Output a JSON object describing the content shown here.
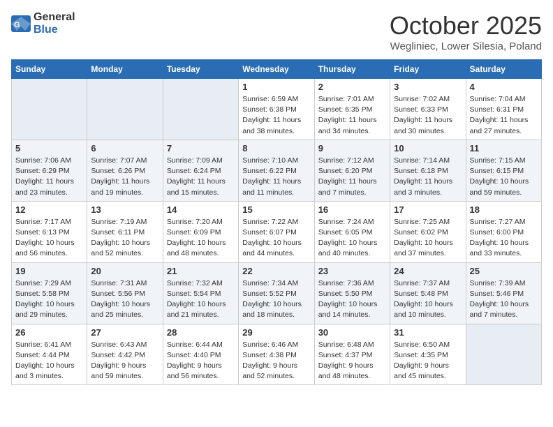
{
  "header": {
    "logo_general": "General",
    "logo_blue": "Blue",
    "month": "October 2025",
    "location": "Wegliniec, Lower Silesia, Poland"
  },
  "days_of_week": [
    "Sunday",
    "Monday",
    "Tuesday",
    "Wednesday",
    "Thursday",
    "Friday",
    "Saturday"
  ],
  "weeks": [
    [
      {
        "date": "",
        "info": ""
      },
      {
        "date": "",
        "info": ""
      },
      {
        "date": "",
        "info": ""
      },
      {
        "date": "1",
        "info": "Sunrise: 6:59 AM\nSunset: 6:38 PM\nDaylight: 11 hours\nand 38 minutes."
      },
      {
        "date": "2",
        "info": "Sunrise: 7:01 AM\nSunset: 6:35 PM\nDaylight: 11 hours\nand 34 minutes."
      },
      {
        "date": "3",
        "info": "Sunrise: 7:02 AM\nSunset: 6:33 PM\nDaylight: 11 hours\nand 30 minutes."
      },
      {
        "date": "4",
        "info": "Sunrise: 7:04 AM\nSunset: 6:31 PM\nDaylight: 11 hours\nand 27 minutes."
      }
    ],
    [
      {
        "date": "5",
        "info": "Sunrise: 7:06 AM\nSunset: 6:29 PM\nDaylight: 11 hours\nand 23 minutes."
      },
      {
        "date": "6",
        "info": "Sunrise: 7:07 AM\nSunset: 6:26 PM\nDaylight: 11 hours\nand 19 minutes."
      },
      {
        "date": "7",
        "info": "Sunrise: 7:09 AM\nSunset: 6:24 PM\nDaylight: 11 hours\nand 15 minutes."
      },
      {
        "date": "8",
        "info": "Sunrise: 7:10 AM\nSunset: 6:22 PM\nDaylight: 11 hours\nand 11 minutes."
      },
      {
        "date": "9",
        "info": "Sunrise: 7:12 AM\nSunset: 6:20 PM\nDaylight: 11 hours\nand 7 minutes."
      },
      {
        "date": "10",
        "info": "Sunrise: 7:14 AM\nSunset: 6:18 PM\nDaylight: 11 hours\nand 3 minutes."
      },
      {
        "date": "11",
        "info": "Sunrise: 7:15 AM\nSunset: 6:15 PM\nDaylight: 10 hours\nand 59 minutes."
      }
    ],
    [
      {
        "date": "12",
        "info": "Sunrise: 7:17 AM\nSunset: 6:13 PM\nDaylight: 10 hours\nand 56 minutes."
      },
      {
        "date": "13",
        "info": "Sunrise: 7:19 AM\nSunset: 6:11 PM\nDaylight: 10 hours\nand 52 minutes."
      },
      {
        "date": "14",
        "info": "Sunrise: 7:20 AM\nSunset: 6:09 PM\nDaylight: 10 hours\nand 48 minutes."
      },
      {
        "date": "15",
        "info": "Sunrise: 7:22 AM\nSunset: 6:07 PM\nDaylight: 10 hours\nand 44 minutes."
      },
      {
        "date": "16",
        "info": "Sunrise: 7:24 AM\nSunset: 6:05 PM\nDaylight: 10 hours\nand 40 minutes."
      },
      {
        "date": "17",
        "info": "Sunrise: 7:25 AM\nSunset: 6:02 PM\nDaylight: 10 hours\nand 37 minutes."
      },
      {
        "date": "18",
        "info": "Sunrise: 7:27 AM\nSunset: 6:00 PM\nDaylight: 10 hours\nand 33 minutes."
      }
    ],
    [
      {
        "date": "19",
        "info": "Sunrise: 7:29 AM\nSunset: 5:58 PM\nDaylight: 10 hours\nand 29 minutes."
      },
      {
        "date": "20",
        "info": "Sunrise: 7:31 AM\nSunset: 5:56 PM\nDaylight: 10 hours\nand 25 minutes."
      },
      {
        "date": "21",
        "info": "Sunrise: 7:32 AM\nSunset: 5:54 PM\nDaylight: 10 hours\nand 21 minutes."
      },
      {
        "date": "22",
        "info": "Sunrise: 7:34 AM\nSunset: 5:52 PM\nDaylight: 10 hours\nand 18 minutes."
      },
      {
        "date": "23",
        "info": "Sunrise: 7:36 AM\nSunset: 5:50 PM\nDaylight: 10 hours\nand 14 minutes."
      },
      {
        "date": "24",
        "info": "Sunrise: 7:37 AM\nSunset: 5:48 PM\nDaylight: 10 hours\nand 10 minutes."
      },
      {
        "date": "25",
        "info": "Sunrise: 7:39 AM\nSunset: 5:46 PM\nDaylight: 10 hours\nand 7 minutes."
      }
    ],
    [
      {
        "date": "26",
        "info": "Sunrise: 6:41 AM\nSunset: 4:44 PM\nDaylight: 10 hours\nand 3 minutes."
      },
      {
        "date": "27",
        "info": "Sunrise: 6:43 AM\nSunset: 4:42 PM\nDaylight: 9 hours\nand 59 minutes."
      },
      {
        "date": "28",
        "info": "Sunrise: 6:44 AM\nSunset: 4:40 PM\nDaylight: 9 hours\nand 56 minutes."
      },
      {
        "date": "29",
        "info": "Sunrise: 6:46 AM\nSunset: 4:38 PM\nDaylight: 9 hours\nand 52 minutes."
      },
      {
        "date": "30",
        "info": "Sunrise: 6:48 AM\nSunset: 4:37 PM\nDaylight: 9 hours\nand 48 minutes."
      },
      {
        "date": "31",
        "info": "Sunrise: 6:50 AM\nSunset: 4:35 PM\nDaylight: 9 hours\nand 45 minutes."
      },
      {
        "date": "",
        "info": ""
      }
    ]
  ]
}
